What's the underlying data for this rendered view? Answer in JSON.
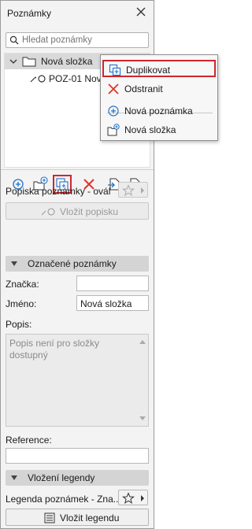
{
  "panel": {
    "title": "Poznámky",
    "search_placeholder": "Hledat poznámky"
  },
  "tree": {
    "folder_label": "Nová složka",
    "item_label": "POZ-01 Nová"
  },
  "toolbar": {
    "icons": [
      "new-note",
      "new-folder",
      "duplicate",
      "delete",
      "import",
      "export"
    ]
  },
  "annotation": {
    "style_label": "Popiska poznámky - ovál",
    "insert_label": "Vložit popisku"
  },
  "marked_section": {
    "title": "Označené poznámky",
    "tag_label": "Značka:",
    "tag_value": "",
    "name_label": "Jméno:",
    "name_value": "Nová složka",
    "desc_label": "Popis:",
    "desc_text": "Popis není pro složky dostupný",
    "ref_label": "Reference:",
    "ref_value": ""
  },
  "legend_section": {
    "title": "Vložení legendy",
    "legend_label": "Legenda poznámek - Zna...",
    "insert_label": "Vložit legendu"
  },
  "context_menu": {
    "items": [
      {
        "label": "Duplikovat",
        "icon": "duplicate-icon",
        "highlighted": true
      },
      {
        "label": "Odstranit",
        "icon": "delete-icon",
        "highlighted": false
      },
      {
        "label": "Nová poznámka",
        "icon": "new-note-icon",
        "highlighted": false
      },
      {
        "label": "Nová složka",
        "icon": "new-folder-icon",
        "highlighted": false
      }
    ]
  },
  "colors": {
    "accent_blue": "#1f6fc5",
    "delete_red": "#e0352b",
    "highlight_red": "#d0262d"
  }
}
